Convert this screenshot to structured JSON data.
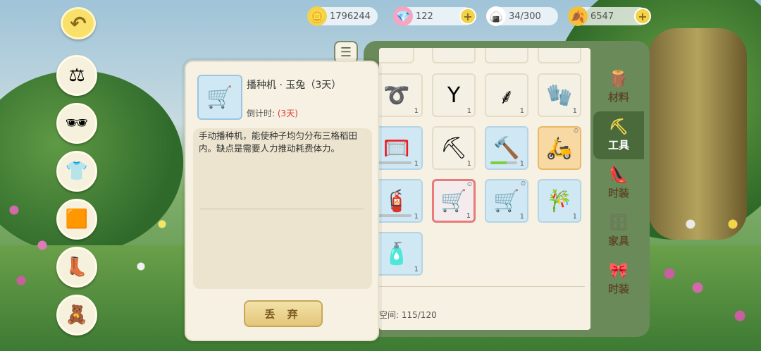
{
  "currencies": [
    {
      "icon": "gold-coin-icon",
      "value": "1796244",
      "has_plus": false
    },
    {
      "icon": "pink-gem-icon",
      "value": "122",
      "has_plus": true
    },
    {
      "icon": "rice-ball-icon",
      "value": "34/300",
      "has_plus": false
    },
    {
      "icon": "gold-leaf-icon",
      "value": "6547",
      "has_plus": true
    }
  ],
  "plus_label": "+",
  "back_label": "↶",
  "left_categories": [
    {
      "icon": "scale-icon",
      "glyph": "⚖"
    },
    {
      "icon": "sunglasses-icon",
      "glyph": "🕶"
    },
    {
      "icon": "tshirt-icon",
      "glyph": "👕"
    },
    {
      "icon": "skirt-icon",
      "glyph": "🟧"
    },
    {
      "icon": "boots-icon",
      "glyph": "👢"
    },
    {
      "icon": "teddy-bear-icon",
      "glyph": "🧸"
    }
  ],
  "list_icon_glyph": "☰",
  "detail": {
    "thumb_glyph": "🛒",
    "name": "播种机 · 玉兔（3天）",
    "timer_label": "倒计时:",
    "timer_value": "(3天)",
    "description": "手动播种机，能使种子均匀分布三格稻田内。缺点是需要人力推动耗费体力。",
    "discard_label": "丢 弃"
  },
  "inventory": {
    "space_label": "空间: 115/120",
    "slots": [
      {
        "name": "rope-icon",
        "glyph": "➰",
        "style": "plain",
        "qty": "1"
      },
      {
        "name": "slingshot-icon",
        "glyph": "Y",
        "style": "plain",
        "qty": "1"
      },
      {
        "name": "sickle-icon",
        "glyph": "⸙",
        "style": "plain",
        "qty": "1"
      },
      {
        "name": "glove-icon",
        "glyph": "🧤",
        "style": "plain",
        "qty": "1"
      },
      {
        "name": "net-icon",
        "glyph": "🥅",
        "style": "blue",
        "qty": "1",
        "bar": "plain"
      },
      {
        "name": "shovel-icon",
        "glyph": "⛏",
        "style": "plain",
        "qty": "1"
      },
      {
        "name": "trowel-icon",
        "glyph": "🔨",
        "style": "blue",
        "qty": "1",
        "bar": "green"
      },
      {
        "name": "scooter-icon",
        "glyph": "🛵",
        "style": "orange",
        "qty": "",
        "clock": "⏲"
      },
      {
        "name": "sprayer-icon",
        "glyph": "🧯",
        "style": "blue",
        "qty": "1",
        "bar": "plain"
      },
      {
        "name": "seeder-icon",
        "glyph": "🛒",
        "style": "selected",
        "qty": "1",
        "clock": "⏲"
      },
      {
        "name": "seeder-icon",
        "glyph": "🛒",
        "style": "blue",
        "qty": "1",
        "clock": "⏲"
      },
      {
        "name": "flute-icon",
        "glyph": "🎋",
        "style": "blue",
        "qty": "1"
      },
      {
        "name": "water-bottle-icon",
        "glyph": "🧴",
        "style": "blue",
        "qty": "1"
      }
    ]
  },
  "tabs": [
    {
      "name": "tab-materials",
      "glyph": "🪵",
      "label": "材料",
      "active": false
    },
    {
      "name": "tab-tools",
      "glyph": "⛏",
      "label": "工具",
      "active": true
    },
    {
      "name": "tab-fashion",
      "glyph": "👠",
      "label": "时装",
      "active": false
    },
    {
      "name": "tab-furniture",
      "glyph": "🗄",
      "label": "家具",
      "active": false
    },
    {
      "name": "tab-fashion-2",
      "glyph": "🎀",
      "label": "时装",
      "active": false
    }
  ]
}
